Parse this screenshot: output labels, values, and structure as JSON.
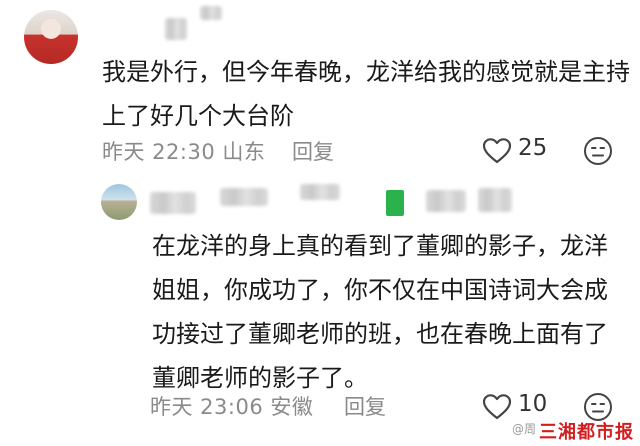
{
  "comment": {
    "text": "我是外行，但今年春晚，龙洋给我的感觉就是主持上了好几个大台阶",
    "time": "昨天 22:30",
    "location": "山东",
    "reply_label": "回复",
    "likes": "25"
  },
  "reply": {
    "text": "在龙洋的身上真的看到了董卿的影子，龙洋姐姐，你成功了，你不仅在中国诗词大会成功接过了董卿老师的班，也在春晚上面有了董卿老师的影子了。",
    "time": "昨天 23:06",
    "location": "安徽",
    "reply_label": "回复",
    "likes": "10"
  },
  "watermark": {
    "weibo": "@周",
    "brand": "三湘都市报"
  },
  "icons": {
    "like": "heart-outline-icon",
    "react": "meh-face-icon"
  },
  "colors": {
    "meta": "#8a8a8a",
    "brand": "#d21e1e",
    "tag": "#2bb24c"
  }
}
